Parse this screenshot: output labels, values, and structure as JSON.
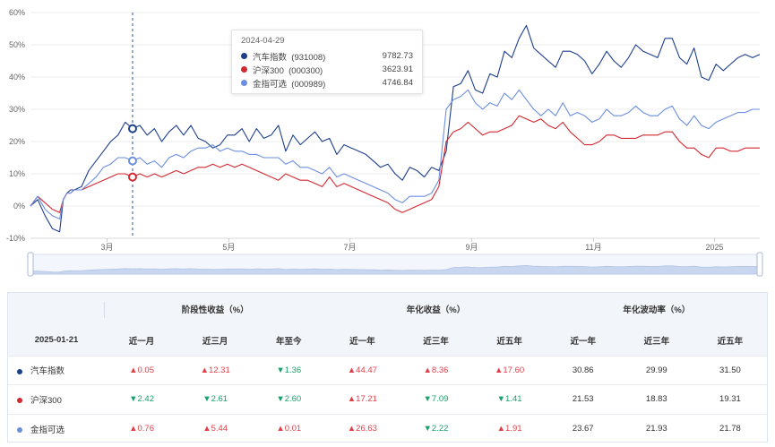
{
  "chart_data": {
    "type": "line",
    "y_axis": {
      "min": -10,
      "max": 60,
      "ticks": [
        "60%",
        "50%",
        "40%",
        "30%",
        "20%",
        "10%",
        "0%",
        "-10%"
      ]
    },
    "x_axis": {
      "labels": [
        "3月",
        "5月",
        "7月",
        "9月",
        "11月",
        "2025"
      ]
    },
    "grid": true,
    "series": [
      {
        "name": "汽车指数",
        "color": "#1d3f8c",
        "x": [
          0,
          0.01,
          0.02,
          0.03,
          0.04,
          0.045,
          0.05,
          0.055,
          0.06,
          0.07,
          0.08,
          0.09,
          0.1,
          0.11,
          0.12,
          0.13,
          0.14,
          0.15,
          0.16,
          0.17,
          0.18,
          0.19,
          0.2,
          0.21,
          0.22,
          0.23,
          0.24,
          0.25,
          0.26,
          0.27,
          0.28,
          0.29,
          0.3,
          0.31,
          0.32,
          0.33,
          0.34,
          0.35,
          0.36,
          0.37,
          0.38,
          0.39,
          0.4,
          0.41,
          0.42,
          0.43,
          0.44,
          0.45,
          0.46,
          0.47,
          0.48,
          0.49,
          0.5,
          0.51,
          0.52,
          0.53,
          0.54,
          0.55,
          0.56,
          0.57,
          0.58,
          0.59,
          0.6,
          0.61,
          0.62,
          0.63,
          0.64,
          0.65,
          0.66,
          0.67,
          0.68,
          0.69,
          0.7,
          0.71,
          0.72,
          0.73,
          0.74,
          0.75,
          0.76,
          0.77,
          0.78,
          0.79,
          0.8,
          0.81,
          0.82,
          0.83,
          0.84,
          0.85,
          0.86,
          0.87,
          0.88,
          0.89,
          0.9,
          0.91,
          0.92,
          0.93,
          0.94,
          0.95,
          0.96,
          0.97,
          0.98,
          0.99,
          1
        ],
        "y": [
          0,
          2,
          -3,
          -7,
          -8,
          2,
          4,
          5,
          5,
          6,
          11,
          14,
          17,
          20,
          22,
          26,
          24,
          25,
          22,
          24,
          20,
          23,
          25,
          22,
          25,
          21,
          20,
          18,
          19,
          22,
          22,
          24,
          20,
          24,
          21,
          22,
          25,
          17,
          22,
          19,
          21,
          23,
          20,
          21,
          16,
          19,
          18,
          17,
          16,
          14,
          12,
          13,
          10,
          8,
          12,
          11,
          9,
          12,
          11,
          17,
          37,
          38,
          42,
          36,
          35,
          41,
          40,
          48,
          46,
          52,
          56,
          49,
          47,
          45,
          43,
          48,
          48,
          47,
          45,
          41,
          44,
          48,
          45,
          43,
          46,
          50,
          48,
          47,
          46,
          52,
          52,
          46,
          44,
          49,
          40,
          39,
          44,
          42,
          44,
          46,
          47,
          46,
          47
        ]
      },
      {
        "name": "沪深300",
        "color": "#d42830",
        "x": [
          0,
          0.01,
          0.02,
          0.03,
          0.04,
          0.045,
          0.05,
          0.055,
          0.06,
          0.07,
          0.08,
          0.09,
          0.1,
          0.11,
          0.12,
          0.13,
          0.14,
          0.15,
          0.16,
          0.17,
          0.18,
          0.19,
          0.2,
          0.21,
          0.22,
          0.23,
          0.24,
          0.25,
          0.26,
          0.27,
          0.28,
          0.29,
          0.3,
          0.31,
          0.32,
          0.33,
          0.34,
          0.35,
          0.36,
          0.37,
          0.38,
          0.39,
          0.4,
          0.41,
          0.42,
          0.43,
          0.44,
          0.45,
          0.46,
          0.47,
          0.48,
          0.49,
          0.5,
          0.51,
          0.52,
          0.53,
          0.54,
          0.55,
          0.56,
          0.57,
          0.58,
          0.59,
          0.6,
          0.61,
          0.62,
          0.63,
          0.64,
          0.65,
          0.66,
          0.67,
          0.68,
          0.69,
          0.7,
          0.71,
          0.72,
          0.73,
          0.74,
          0.75,
          0.76,
          0.77,
          0.78,
          0.79,
          0.8,
          0.81,
          0.82,
          0.83,
          0.84,
          0.85,
          0.86,
          0.87,
          0.88,
          0.89,
          0.9,
          0.91,
          0.92,
          0.93,
          0.94,
          0.95,
          0.96,
          0.97,
          0.98,
          0.99,
          1
        ],
        "y": [
          0,
          3,
          1,
          -1,
          -2,
          2,
          4,
          4,
          5,
          5,
          6,
          7,
          8,
          9,
          10,
          10,
          9,
          10,
          9,
          10,
          9,
          10,
          11,
          10,
          11,
          12,
          12,
          13,
          12,
          13,
          12,
          13,
          12,
          11,
          10,
          9,
          8,
          10,
          9,
          8,
          8,
          7,
          6,
          9,
          6,
          7,
          6,
          5,
          4,
          3,
          2,
          1,
          -1,
          -2,
          -1,
          0,
          1,
          2,
          6,
          20,
          23,
          24,
          26,
          24,
          22,
          23,
          23,
          24,
          25,
          28,
          27,
          26,
          27,
          25,
          24,
          26,
          23,
          21,
          19,
          19,
          20,
          22,
          22,
          21,
          21,
          21,
          22,
          22,
          22,
          23,
          23,
          20,
          18,
          18,
          16,
          15,
          18,
          18,
          17,
          17,
          18,
          18,
          18
        ]
      },
      {
        "name": "金指可选",
        "color": "#6b8fe0",
        "x": [
          0,
          0.01,
          0.02,
          0.03,
          0.04,
          0.045,
          0.05,
          0.055,
          0.06,
          0.07,
          0.08,
          0.09,
          0.1,
          0.11,
          0.12,
          0.13,
          0.14,
          0.15,
          0.16,
          0.17,
          0.18,
          0.19,
          0.2,
          0.21,
          0.22,
          0.23,
          0.24,
          0.25,
          0.26,
          0.27,
          0.28,
          0.29,
          0.3,
          0.31,
          0.32,
          0.33,
          0.34,
          0.35,
          0.36,
          0.37,
          0.38,
          0.39,
          0.4,
          0.41,
          0.42,
          0.43,
          0.44,
          0.45,
          0.46,
          0.47,
          0.48,
          0.49,
          0.5,
          0.51,
          0.52,
          0.53,
          0.54,
          0.55,
          0.56,
          0.57,
          0.58,
          0.59,
          0.6,
          0.61,
          0.62,
          0.63,
          0.64,
          0.65,
          0.66,
          0.67,
          0.68,
          0.69,
          0.7,
          0.71,
          0.72,
          0.73,
          0.74,
          0.75,
          0.76,
          0.77,
          0.78,
          0.79,
          0.8,
          0.81,
          0.82,
          0.83,
          0.84,
          0.85,
          0.86,
          0.87,
          0.88,
          0.89,
          0.9,
          0.91,
          0.92,
          0.93,
          0.94,
          0.95,
          0.96,
          0.97,
          0.98,
          0.99,
          1
        ],
        "y": [
          0,
          3,
          -1,
          -3,
          -4,
          2,
          4,
          4,
          5,
          5,
          7,
          9,
          12,
          13,
          15,
          15,
          14,
          15,
          13,
          14,
          12,
          15,
          16,
          15,
          17,
          18,
          18,
          19,
          17,
          18,
          17,
          17,
          16,
          16,
          15,
          15,
          15,
          13,
          14,
          12,
          12,
          11,
          10,
          12,
          9,
          10,
          9,
          8,
          7,
          6,
          5,
          4,
          2,
          1,
          3,
          3,
          3,
          4,
          8,
          30,
          33,
          34,
          36,
          32,
          30,
          32,
          31,
          35,
          33,
          36,
          33,
          30,
          28,
          30,
          28,
          32,
          28,
          29,
          28,
          26,
          27,
          30,
          28,
          28,
          29,
          31,
          29,
          28,
          28,
          30,
          31,
          27,
          25,
          28,
          25,
          24,
          26,
          27,
          28,
          29,
          29,
          30,
          30
        ]
      }
    ],
    "cursor": {
      "x_index": 16,
      "date": "2024-04-29"
    }
  },
  "tooltip": {
    "date": "2024-04-29",
    "rows": [
      {
        "name": "汽车指数",
        "code": "(931008)",
        "value": "9782.73",
        "color": "#1d3f8c"
      },
      {
        "name": "沪深300",
        "code": "(000300)",
        "value": "3623.91",
        "color": "#d42830"
      },
      {
        "name": "金指可选",
        "code": "(000989)",
        "value": "4746.84",
        "color": "#6b8fe0"
      }
    ]
  },
  "table": {
    "date_label": "2025-01-21",
    "groups": [
      "阶段性收益（%）",
      "年化收益（%）",
      "年化波动率（%）"
    ],
    "sub_headers": [
      "近一月",
      "近三月",
      "年至今",
      "近一年",
      "近三年",
      "近五年",
      "近一年",
      "近三年",
      "近五年"
    ],
    "rows": [
      {
        "name": "汽车指数",
        "color": "#1d3f8c",
        "cells": [
          {
            "text": "▲0.05",
            "dir": "up"
          },
          {
            "text": "▲12.31",
            "dir": "up"
          },
          {
            "text": "▼1.36",
            "dir": "down"
          },
          {
            "text": "▲44.47",
            "dir": "up"
          },
          {
            "text": "▲8.36",
            "dir": "up"
          },
          {
            "text": "▲17.60",
            "dir": "up"
          },
          {
            "text": "30.86",
            "dir": "neutral"
          },
          {
            "text": "29.99",
            "dir": "neutral"
          },
          {
            "text": "31.50",
            "dir": "neutral"
          }
        ]
      },
      {
        "name": "沪深300",
        "color": "#d42830",
        "cells": [
          {
            "text": "▼2.42",
            "dir": "down"
          },
          {
            "text": "▼2.61",
            "dir": "down"
          },
          {
            "text": "▼2.60",
            "dir": "down"
          },
          {
            "text": "▲17.21",
            "dir": "up"
          },
          {
            "text": "▼7.09",
            "dir": "down"
          },
          {
            "text": "▼1.41",
            "dir": "down"
          },
          {
            "text": "21.53",
            "dir": "neutral"
          },
          {
            "text": "18.83",
            "dir": "neutral"
          },
          {
            "text": "19.31",
            "dir": "neutral"
          }
        ]
      },
      {
        "name": "金指可选",
        "color": "#6b8fe0",
        "cells": [
          {
            "text": "▲0.76",
            "dir": "up"
          },
          {
            "text": "▲5.44",
            "dir": "up"
          },
          {
            "text": "▲0.01",
            "dir": "up"
          },
          {
            "text": "▲26.63",
            "dir": "up"
          },
          {
            "text": "▼2.22",
            "dir": "down"
          },
          {
            "text": "▲1.91",
            "dir": "up"
          },
          {
            "text": "23.67",
            "dir": "neutral"
          },
          {
            "text": "21.93",
            "dir": "neutral"
          },
          {
            "text": "21.78",
            "dir": "neutral"
          }
        ]
      }
    ]
  }
}
